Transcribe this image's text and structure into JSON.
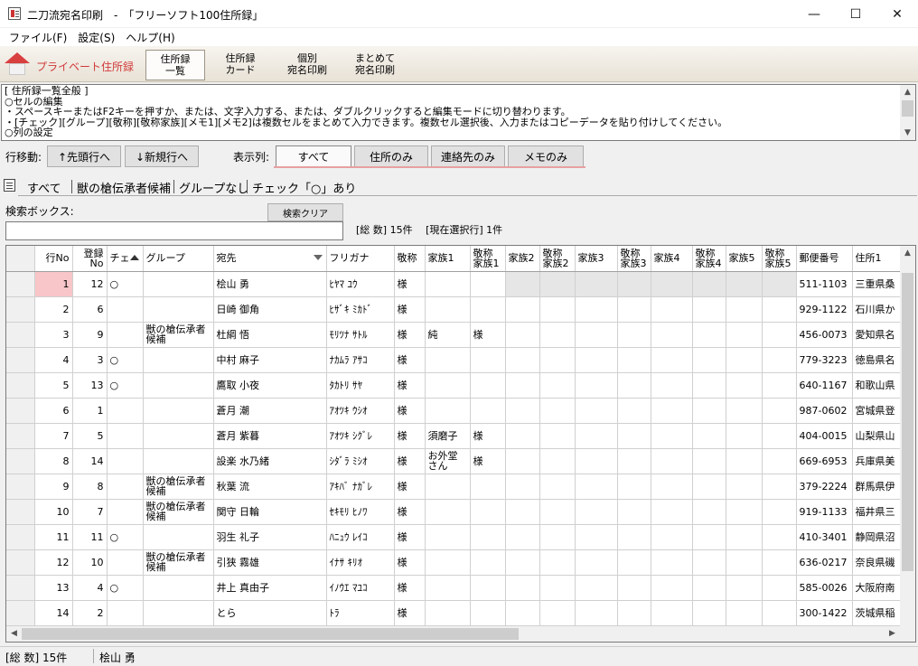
{
  "window": {
    "title": "二刀流宛名印刷　-　「フリーソフト100住所録」",
    "minimize": "—",
    "maximize": "☐",
    "close": "✕"
  },
  "menu": [
    "ファイル(F)",
    "設定(S)",
    "ヘルプ(H)"
  ],
  "ribbon": {
    "brand": "プライベート住所録",
    "tabs": [
      {
        "line1": "住所録",
        "line2": "一覧"
      },
      {
        "line1": "住所録",
        "line2": "カード"
      },
      {
        "line1": "個別",
        "line2": "宛名印刷"
      },
      {
        "line1": "まとめて",
        "line2": "宛名印刷"
      }
    ]
  },
  "info": {
    "lines": [
      "[ 住所録一覧全般 ]",
      "○セルの編集",
      "・スペースキーまたはF2キーを押すか、または、文字入力する、または、ダブルクリックすると編集モードに切り替わります。",
      "・[チェック][グループ][敬称][敬称家族][メモ1][メモ2]は複数セルをまとめて入力できます。複数セル選択後、入力またはコピーデータを貼り付けしてください。",
      "○列の設定"
    ]
  },
  "toolbar": {
    "row_move_label": "行移動:",
    "first_row": "↑先頭行へ",
    "new_row": "↓新規行へ",
    "display_label": "表示列:",
    "view_all": "すべて",
    "view_address": "住所のみ",
    "view_contact": "連絡先のみ",
    "view_memo": "メモのみ"
  },
  "tabs": [
    "すべて",
    "獣の槍伝承者候補",
    "グループなし",
    "チェック「○」あり"
  ],
  "search": {
    "label": "検索ボックス:",
    "clear": "検索クリア",
    "value": "",
    "summary": "[総 数] 15件　 [現在選択行] 1件"
  },
  "table": {
    "headers": [
      {
        "text": "",
        "w": 31
      },
      {
        "text": "行No",
        "w": 42,
        "align": "right"
      },
      {
        "text": "登録\nNo",
        "w": 38,
        "align": "right"
      },
      {
        "text": "チェ",
        "w": 40,
        "sort": "up"
      },
      {
        "text": "グループ",
        "w": 78
      },
      {
        "text": "宛先",
        "w": 125,
        "sort": "down"
      },
      {
        "text": "フリガナ",
        "w": 75
      },
      {
        "text": "敬称",
        "w": 34
      },
      {
        "text": "家族1",
        "w": 50
      },
      {
        "text": "敬称\n家族1",
        "w": 39
      },
      {
        "text": "家族2",
        "w": 38
      },
      {
        "text": "敬称\n家族2",
        "w": 39
      },
      {
        "text": "家族3",
        "w": 47
      },
      {
        "text": "敬称\n家族3",
        "w": 37
      },
      {
        "text": "家族4",
        "w": 46
      },
      {
        "text": "敬称\n家族4",
        "w": 37
      },
      {
        "text": "家族5",
        "w": 40
      },
      {
        "text": "敬称\n家族5",
        "w": 38
      },
      {
        "text": "郵便番号",
        "w": 62
      },
      {
        "text": "住所1",
        "w": 60
      }
    ],
    "rows": [
      [
        "1",
        "12",
        "○",
        "",
        "桧山 勇",
        "ﾋﾔﾏ ﾕｳ",
        "様",
        "",
        "",
        "",
        "",
        "",
        "",
        "",
        "",
        "",
        "",
        "511-1103",
        "三重県桑"
      ],
      [
        "2",
        "6",
        "",
        "",
        "日崎 御角",
        "ﾋｻﾞｷ ﾐｶﾄﾞ",
        "様",
        "",
        "",
        "",
        "",
        "",
        "",
        "",
        "",
        "",
        "",
        "929-1122",
        "石川県か"
      ],
      [
        "3",
        "9",
        "",
        "獣の槍伝承者候補",
        "杜綱 悟",
        "ﾓﾘﾂﾅ ｻﾄﾙ",
        "様",
        "純",
        "様",
        "",
        "",
        "",
        "",
        "",
        "",
        "",
        "",
        "456-0073",
        "愛知県名"
      ],
      [
        "4",
        "3",
        "○",
        "",
        "中村 麻子",
        "ﾅｶﾑﾗ ｱｻｺ",
        "様",
        "",
        "",
        "",
        "",
        "",
        "",
        "",
        "",
        "",
        "",
        "779-3223",
        "徳島県名"
      ],
      [
        "5",
        "13",
        "○",
        "",
        "鷹取 小夜",
        "ﾀｶﾄﾘ ｻﾔ",
        "様",
        "",
        "",
        "",
        "",
        "",
        "",
        "",
        "",
        "",
        "",
        "640-1167",
        "和歌山県"
      ],
      [
        "6",
        "1",
        "",
        "",
        "蒼月 潮",
        "ｱｵﾂｷ ｳｼｵ",
        "様",
        "",
        "",
        "",
        "",
        "",
        "",
        "",
        "",
        "",
        "",
        "987-0602",
        "宮城県登"
      ],
      [
        "7",
        "5",
        "",
        "",
        "蒼月 紫暮",
        "ｱｵﾂｷ ｼｸﾞﾚ",
        "様",
        "須磨子",
        "様",
        "",
        "",
        "",
        "",
        "",
        "",
        "",
        "",
        "404-0015",
        "山梨県山"
      ],
      [
        "8",
        "14",
        "",
        "",
        "設楽 水乃緒",
        "ｼﾀﾞﾗ ﾐｼｵ",
        "様",
        "お外堂さん",
        "様",
        "",
        "",
        "",
        "",
        "",
        "",
        "",
        "",
        "669-6953",
        "兵庫県美"
      ],
      [
        "9",
        "8",
        "",
        "獣の槍伝承者候補",
        "秋葉 流",
        "ｱｷﾊﾞ ﾅｶﾞﾚ",
        "様",
        "",
        "",
        "",
        "",
        "",
        "",
        "",
        "",
        "",
        "",
        "379-2224",
        "群馬県伊"
      ],
      [
        "10",
        "7",
        "",
        "獣の槍伝承者候補",
        "関守 日輪",
        "ｾｷﾓﾘ ﾋﾉﾜ",
        "様",
        "",
        "",
        "",
        "",
        "",
        "",
        "",
        "",
        "",
        "",
        "919-1133",
        "福井県三"
      ],
      [
        "11",
        "11",
        "○",
        "",
        "羽生 礼子",
        "ﾊﾆｭｳ ﾚｲｺ",
        "様",
        "",
        "",
        "",
        "",
        "",
        "",
        "",
        "",
        "",
        "",
        "410-3401",
        "静岡県沼"
      ],
      [
        "12",
        "10",
        "",
        "獣の槍伝承者候補",
        "引狭 霧雄",
        "ｲﾅｻ ｷﾘｵ",
        "様",
        "",
        "",
        "",
        "",
        "",
        "",
        "",
        "",
        "",
        "",
        "636-0217",
        "奈良県磯"
      ],
      [
        "13",
        "4",
        "○",
        "",
        "井上 真由子",
        "ｲﾉｳｴ ﾏﾕｺ",
        "様",
        "",
        "",
        "",
        "",
        "",
        "",
        "",
        "",
        "",
        "",
        "585-0026",
        "大阪府南"
      ],
      [
        "14",
        "2",
        "",
        "",
        "とら",
        "ﾄﾗ",
        "様",
        "",
        "",
        "",
        "",
        "",
        "",
        "",
        "",
        "",
        "",
        "300-1422",
        "茨城県稲"
      ]
    ]
  },
  "status": {
    "total": "[総 数] 15件",
    "current": "桧山 勇"
  }
}
